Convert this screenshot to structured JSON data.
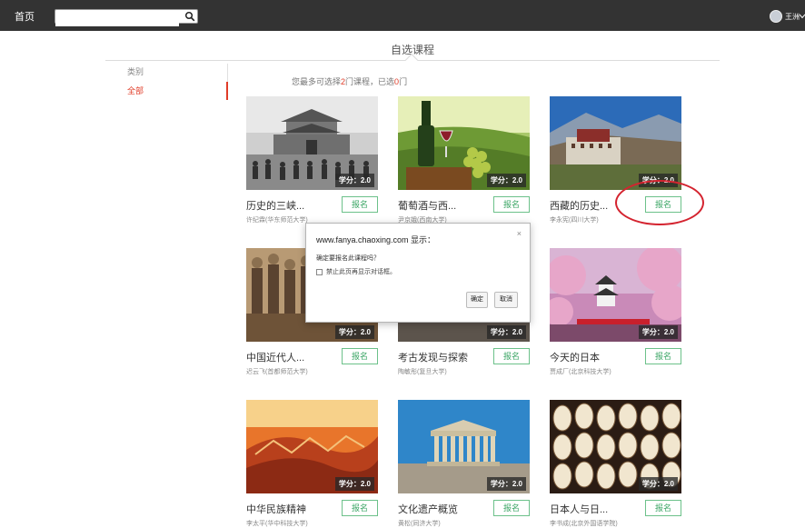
{
  "topbar": {
    "home": "首页",
    "search_value": "",
    "user_name": "王洲"
  },
  "header": {
    "title": "自选课程"
  },
  "sidebar": {
    "category_title": "类别",
    "active": "全部"
  },
  "notice": {
    "prefix": "您最多可选择",
    "max": "2",
    "middle": "门课程，已选",
    "selected": "0",
    "suffix": "门"
  },
  "courses": [
    {
      "title": "历史的三峡...",
      "teacher": "许纪霖(华东师范大学)",
      "credit": "学分：2.0",
      "enroll": "报名"
    },
    {
      "title": "葡萄酒与西...",
      "teacher": "尹京娥(西南大学)",
      "credit": "学分：2.0",
      "enroll": "报名"
    },
    {
      "title": "西藏的历史...",
      "teacher": "李永宪(四川大学)",
      "credit": "学分：2.0",
      "enroll": "报名"
    },
    {
      "title": "中国近代人...",
      "teacher": "迟云飞(首都师范大学)",
      "credit": "学分：2.0",
      "enroll": "报名"
    },
    {
      "title": "考古发现与探索",
      "teacher": "陶敏彤(复旦大学)",
      "credit": "学分：2.0",
      "enroll": "报名"
    },
    {
      "title": "今天的日本",
      "teacher": "贾成厂(北京科技大学)",
      "credit": "学分：2.0",
      "enroll": "报名"
    },
    {
      "title": "中华民族精神",
      "teacher": "李太平(华中科技大学)",
      "credit": "学分：2.0",
      "enroll": "报名"
    },
    {
      "title": "文化遗产概览",
      "teacher": "黄松(同济大学)",
      "credit": "学分：2.0",
      "enroll": "报名"
    },
    {
      "title": "日本人与日...",
      "teacher": "李书成(北京外国语学院)",
      "credit": "学分：2.0",
      "enroll": "报名"
    }
  ],
  "dialog": {
    "title": "www.fanya.chaoxing.com 显示：",
    "message": "确定要报名此课程吗？",
    "checkbox_label": "禁止此页再显示对话框。",
    "ok": "确定",
    "cancel": "取消",
    "close": "×"
  }
}
